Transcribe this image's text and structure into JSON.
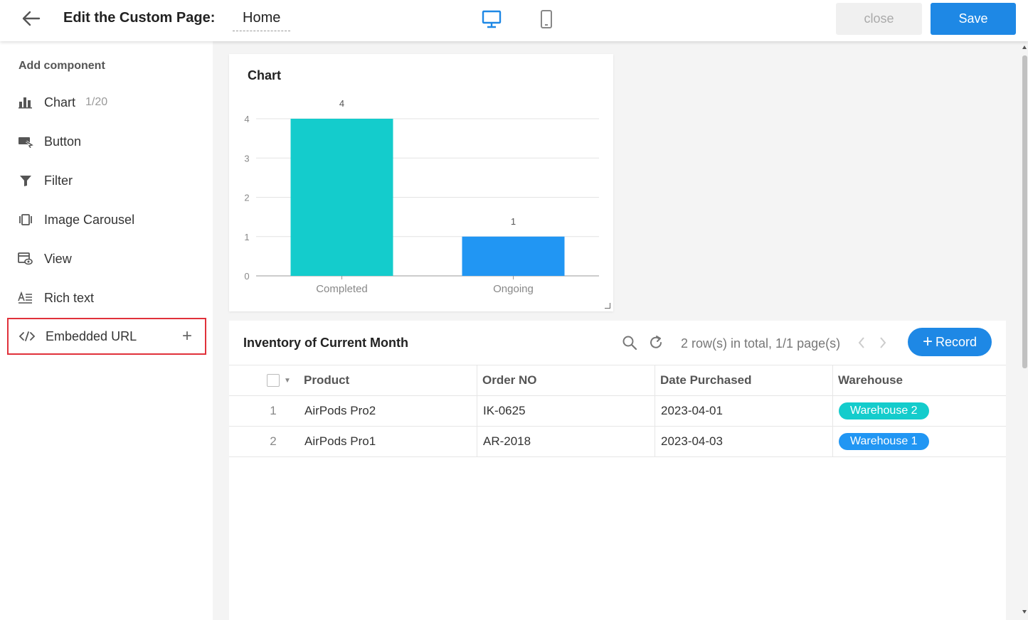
{
  "header": {
    "title_label": "Edit the Custom Page:",
    "page_name": "Home",
    "close_label": "close",
    "save_label": "Save",
    "active_device": "desktop"
  },
  "sidebar": {
    "title": "Add component",
    "items": [
      {
        "label": "Chart",
        "count": "1/20",
        "icon": "bar-chart-icon"
      },
      {
        "label": "Button",
        "count": "",
        "icon": "button-cursor-icon"
      },
      {
        "label": "Filter",
        "count": "",
        "icon": "funnel-icon"
      },
      {
        "label": "Image Carousel",
        "count": "",
        "icon": "carousel-icon"
      },
      {
        "label": "View",
        "count": "",
        "icon": "view-icon"
      },
      {
        "label": "Rich text",
        "count": "",
        "icon": "rich-text-icon"
      },
      {
        "label": "Embedded URL",
        "count": "",
        "icon": "code-icon",
        "selected": true
      }
    ]
  },
  "chart_card": {
    "title": "Chart"
  },
  "chart_data": {
    "type": "bar",
    "categories": [
      "Completed",
      "Ongoing"
    ],
    "values": [
      4,
      1
    ],
    "colors": [
      "#14cccc",
      "#2196f3"
    ],
    "ylim": [
      0,
      4
    ],
    "yticks": [
      0,
      1,
      2,
      3,
      4
    ],
    "title": "Chart",
    "xlabel": "",
    "ylabel": "",
    "grid": true,
    "data_labels": true
  },
  "table": {
    "title": "Inventory of Current Month",
    "rows_info": "2 row(s) in total, 1/1 page(s)",
    "record_label": "Record",
    "columns": [
      "Product",
      "Order NO",
      "Date Purchased",
      "Warehouse"
    ],
    "rows": [
      {
        "num": "1",
        "product": "AirPods Pro2",
        "order": "IK-0625",
        "date": "2023-04-01",
        "warehouse": "Warehouse 2",
        "tag_color": "#14cccc"
      },
      {
        "num": "2",
        "product": "AirPods Pro1",
        "order": "AR-2018",
        "date": "2023-04-03",
        "warehouse": "Warehouse 1",
        "tag_color": "#2196f3"
      }
    ]
  },
  "colors": {
    "primary": "#1e88e5",
    "selected_border": "#e0313a",
    "device_active": "#1e88e5",
    "device_inactive": "#888888"
  }
}
